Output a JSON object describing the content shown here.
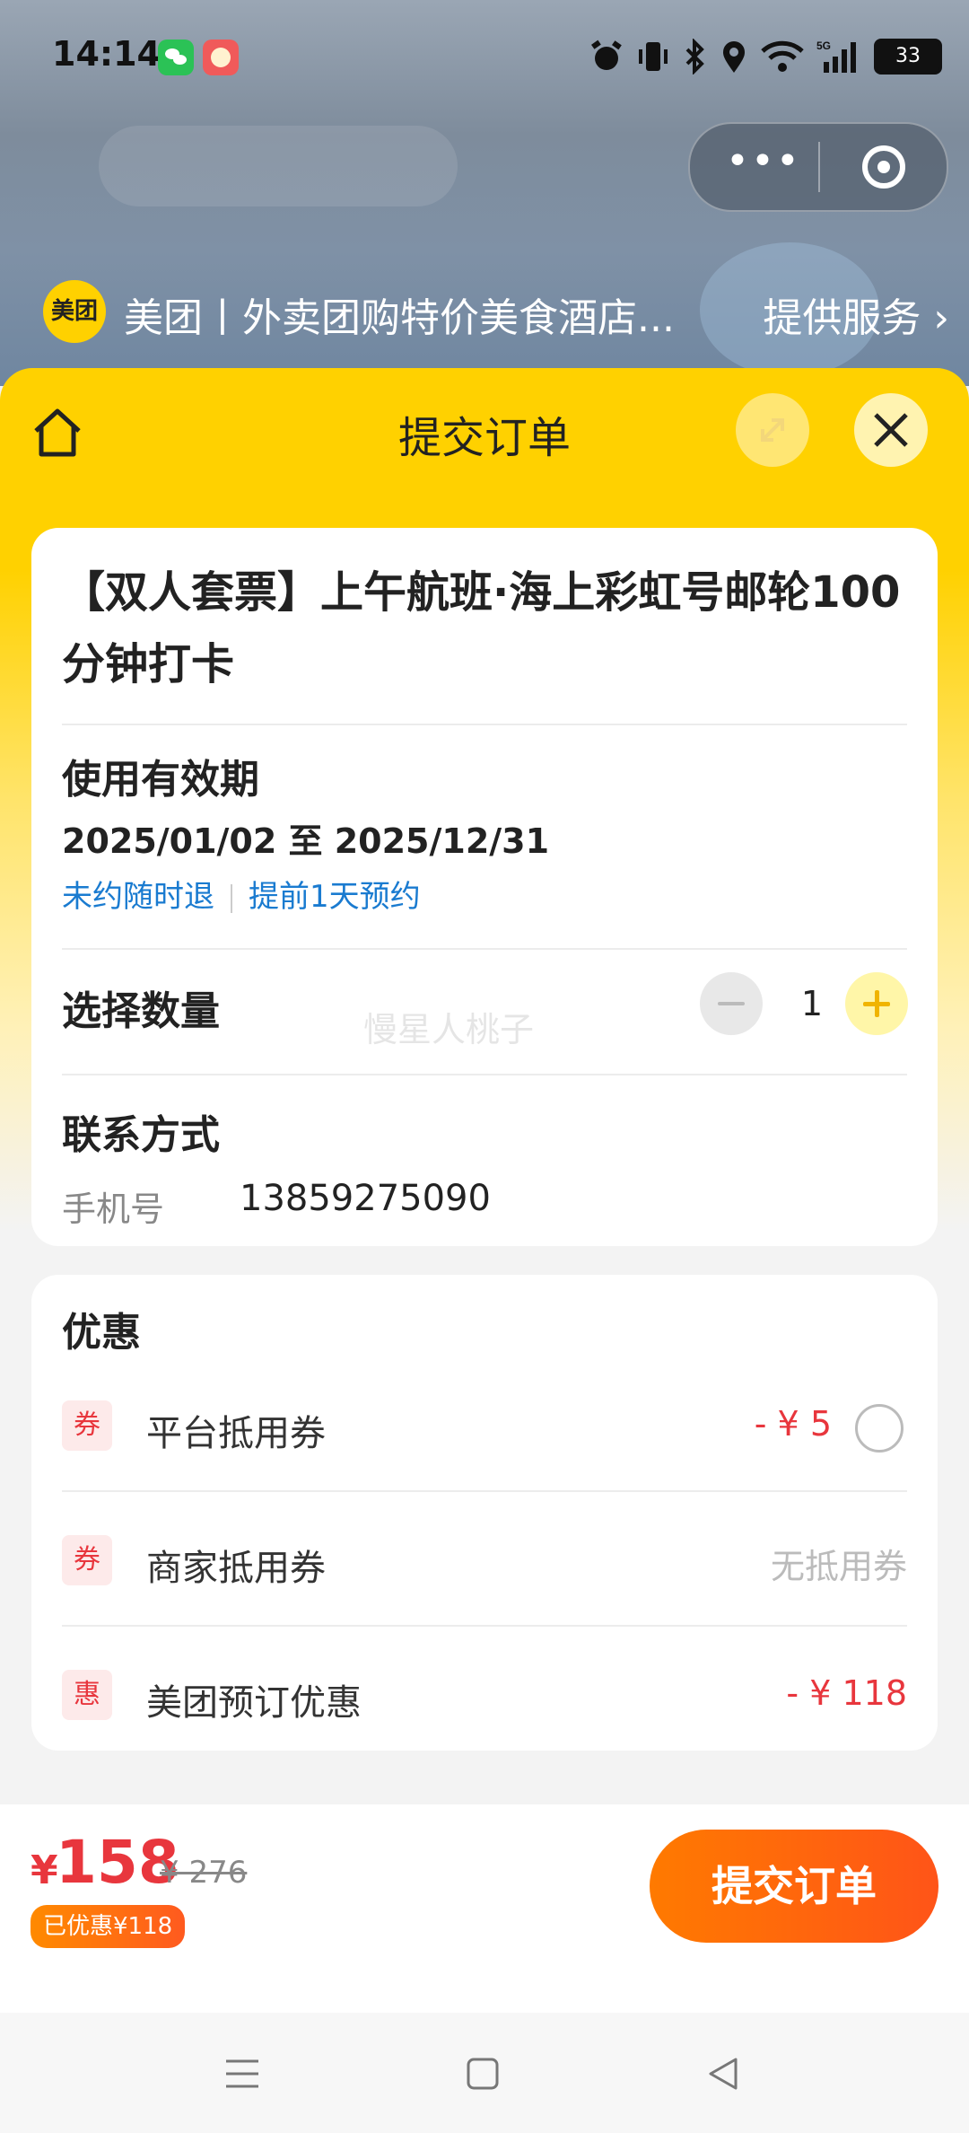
{
  "status": {
    "time": "14:14",
    "battery": "33"
  },
  "mini_header": {
    "logo": "美团",
    "title": "美团丨外卖团购特价美食酒店...",
    "link": "提供服务"
  },
  "sheet": {
    "title": "提交订单"
  },
  "product": {
    "title": "【双人套票】上午航班·海上彩虹号邮轮100分钟打卡"
  },
  "validity": {
    "label": "使用有效期",
    "range": "2025/01/02 至 2025/12/31",
    "tags": [
      "未约随时退",
      "提前1天预约"
    ]
  },
  "quantity": {
    "label": "选择数量",
    "value": "1",
    "watermark": "慢星人桃子"
  },
  "contact": {
    "label": "联系方式",
    "phone_label": "手机号",
    "phone": "13859275090"
  },
  "discounts": {
    "label": "优惠",
    "items": [
      {
        "icon": "券",
        "name": "平台抵用券",
        "value": "- ¥ 5"
      },
      {
        "icon": "券",
        "name": "商家抵用券",
        "value": "无抵用券"
      },
      {
        "icon": "惠",
        "name": "美团预订优惠",
        "value": "- ¥ 118"
      }
    ]
  },
  "footer": {
    "currency": "¥",
    "price": "158",
    "original": "¥ 276",
    "saved": "已优惠¥118",
    "submit": "提交订单"
  },
  "colors": {
    "brand_yellow": "#ffd100",
    "accent_red": "#e8363d",
    "button_orange": "#ff6a10",
    "link_blue": "#1a7bd0"
  }
}
